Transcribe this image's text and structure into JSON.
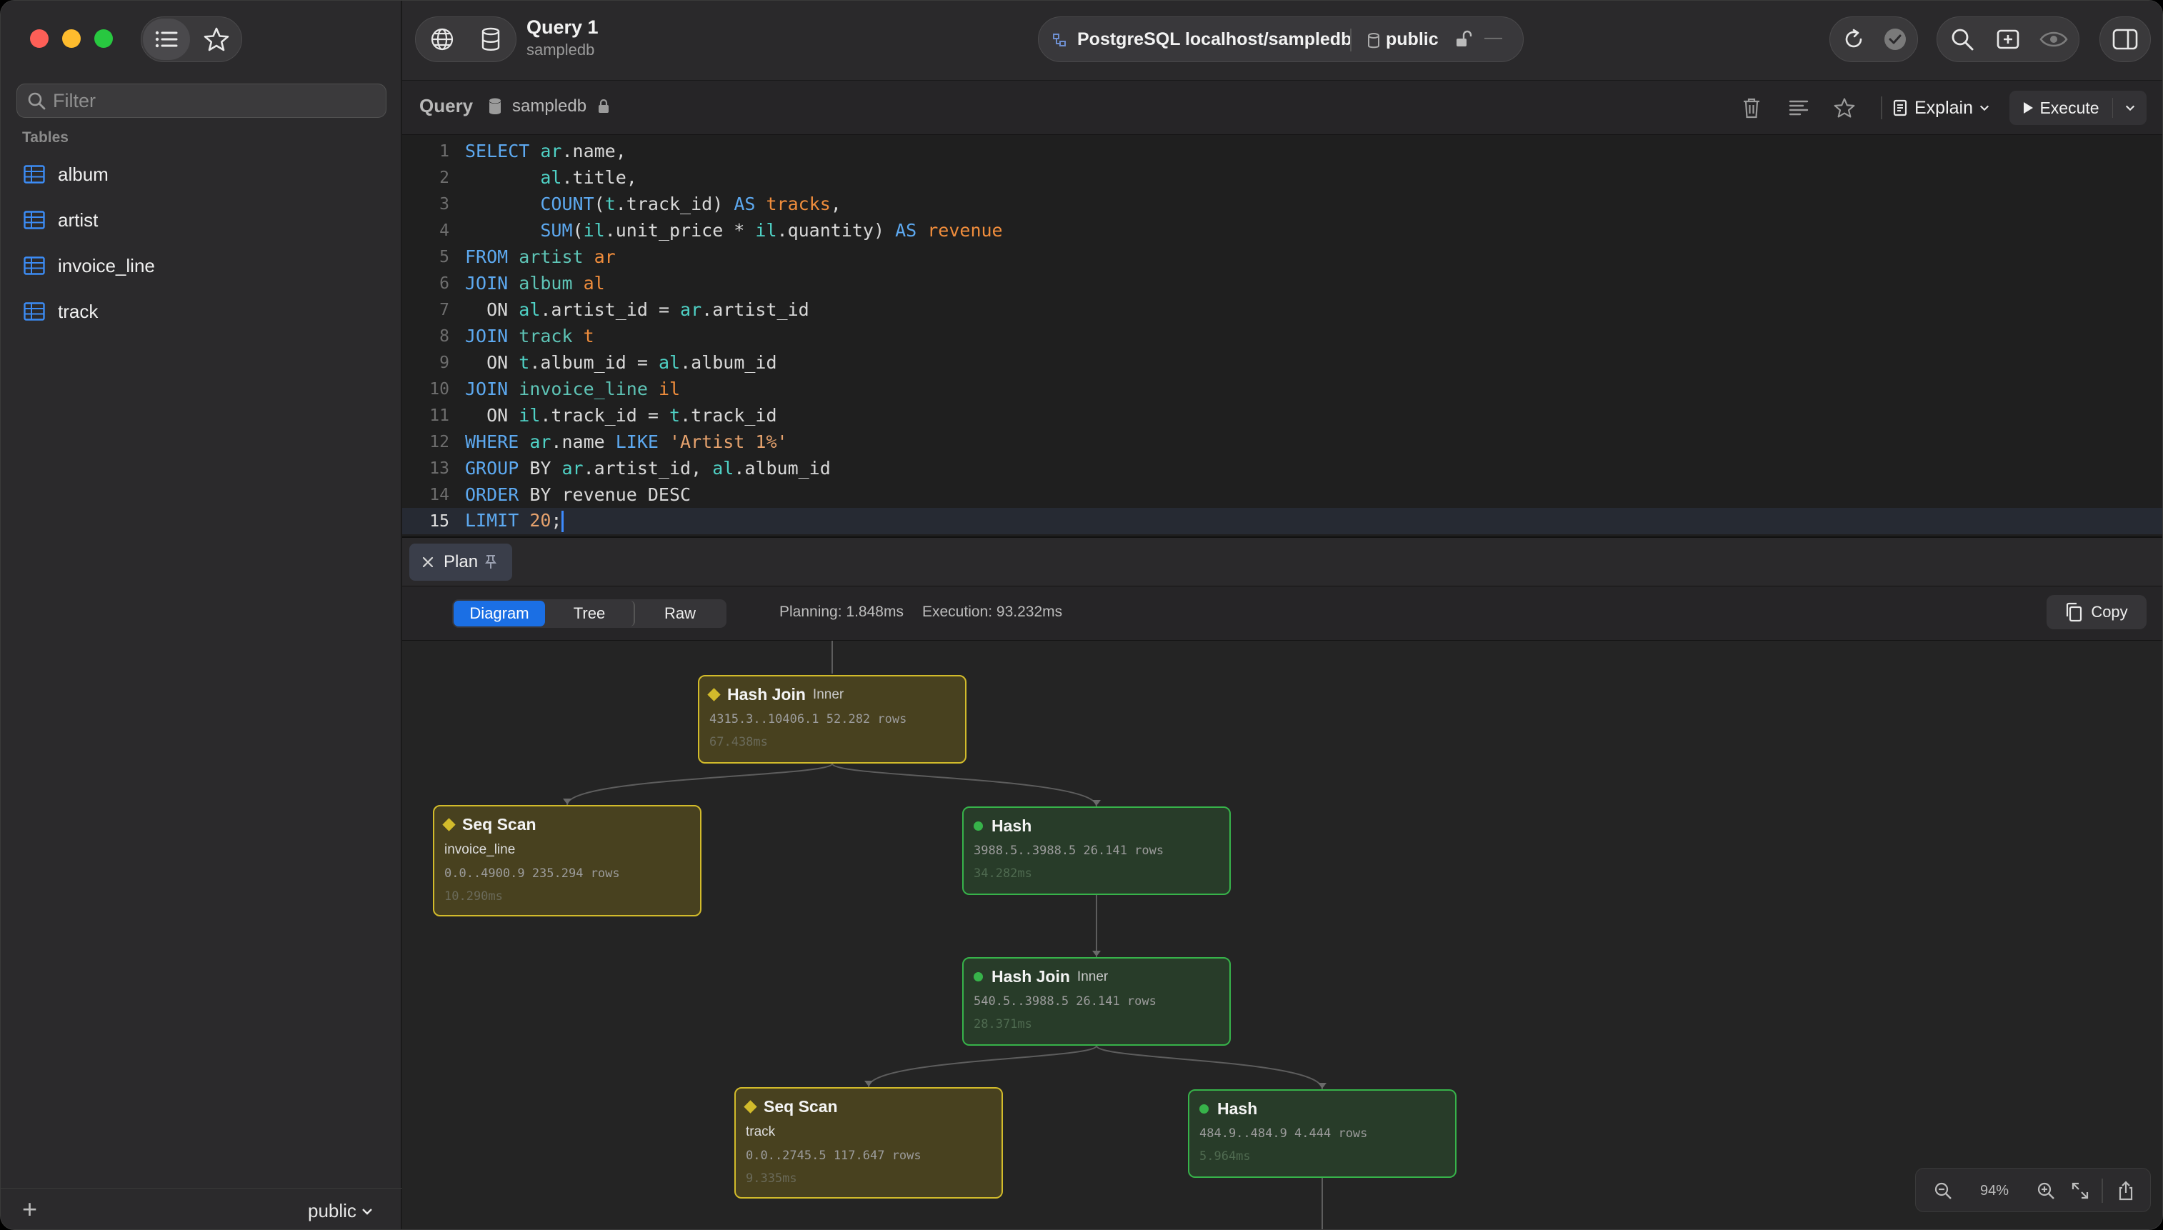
{
  "query_tab": {
    "title": "Query 1",
    "database": "sampledb"
  },
  "connection": {
    "label": "PostgreSQL localhost/sampledb",
    "schema": "public",
    "dash": "—"
  },
  "sidebar": {
    "filter_placeholder": "Filter",
    "section": "Tables",
    "tables": [
      "album",
      "artist",
      "invoice_line",
      "track"
    ],
    "footer_add": "+",
    "schema_select": "public"
  },
  "query_header": {
    "label": "Query",
    "database": "sampledb",
    "explain": "Explain",
    "execute": "Execute"
  },
  "editor": {
    "current_line": 15,
    "lines": [
      {
        "n": "1",
        "parts": [
          [
            "kw",
            "SELECT "
          ],
          [
            "al",
            "ar"
          ],
          [
            "tx",
            ".name,"
          ]
        ]
      },
      {
        "n": "2",
        "parts": [
          [
            "tx",
            "       "
          ],
          [
            "al",
            "al"
          ],
          [
            "tx",
            ".title,"
          ]
        ]
      },
      {
        "n": "3",
        "parts": [
          [
            "tx",
            "       "
          ],
          [
            "fn",
            "COUNT"
          ],
          [
            "tx",
            "("
          ],
          [
            "al",
            "t"
          ],
          [
            "tx",
            ".track_id) "
          ],
          [
            "kw",
            "AS "
          ],
          [
            "or",
            "tracks"
          ],
          [
            "tx",
            ","
          ]
        ]
      },
      {
        "n": "4",
        "parts": [
          [
            "tx",
            "       "
          ],
          [
            "fn",
            "SUM"
          ],
          [
            "tx",
            "("
          ],
          [
            "al",
            "il"
          ],
          [
            "tx",
            ".unit_price * "
          ],
          [
            "al",
            "il"
          ],
          [
            "tx",
            ".quantity) "
          ],
          [
            "kw",
            "AS "
          ],
          [
            "or",
            "revenue"
          ]
        ]
      },
      {
        "n": "5",
        "parts": [
          [
            "kw",
            "FROM "
          ],
          [
            "tb",
            "artist "
          ],
          [
            "or",
            "ar"
          ]
        ]
      },
      {
        "n": "6",
        "parts": [
          [
            "kw",
            "JOIN "
          ],
          [
            "tb",
            "album "
          ],
          [
            "or",
            "al"
          ]
        ]
      },
      {
        "n": "7",
        "parts": [
          [
            "tx",
            "  ON "
          ],
          [
            "al",
            "al"
          ],
          [
            "tx",
            ".artist_id = "
          ],
          [
            "al",
            "ar"
          ],
          [
            "tx",
            ".artist_id"
          ]
        ]
      },
      {
        "n": "8",
        "parts": [
          [
            "kw",
            "JOIN "
          ],
          [
            "tb",
            "track "
          ],
          [
            "or",
            "t"
          ]
        ]
      },
      {
        "n": "9",
        "parts": [
          [
            "tx",
            "  ON "
          ],
          [
            "al",
            "t"
          ],
          [
            "tx",
            ".album_id = "
          ],
          [
            "al",
            "al"
          ],
          [
            "tx",
            ".album_id"
          ]
        ]
      },
      {
        "n": "10",
        "parts": [
          [
            "kw",
            "JOIN "
          ],
          [
            "tb",
            "invoice_line "
          ],
          [
            "or",
            "il"
          ]
        ]
      },
      {
        "n": "11",
        "parts": [
          [
            "tx",
            "  ON "
          ],
          [
            "al",
            "il"
          ],
          [
            "tx",
            ".track_id = "
          ],
          [
            "al",
            "t"
          ],
          [
            "tx",
            ".track_id"
          ]
        ]
      },
      {
        "n": "12",
        "parts": [
          [
            "kw",
            "WHERE "
          ],
          [
            "al",
            "ar"
          ],
          [
            "tx",
            ".name "
          ],
          [
            "kw",
            "LIKE "
          ],
          [
            "st",
            "'Artist 1%'"
          ]
        ]
      },
      {
        "n": "13",
        "parts": [
          [
            "kw",
            "GROUP "
          ],
          [
            "tx",
            "BY "
          ],
          [
            "al",
            "ar"
          ],
          [
            "tx",
            ".artist_id, "
          ],
          [
            "al",
            "al"
          ],
          [
            "tx",
            ".album_id"
          ]
        ]
      },
      {
        "n": "14",
        "parts": [
          [
            "kw",
            "ORDER "
          ],
          [
            "tx",
            "BY revenue DESC"
          ]
        ]
      },
      {
        "n": "15",
        "parts": [
          [
            "kw",
            "LIMIT "
          ],
          [
            "nm",
            "20"
          ],
          [
            "tx",
            ";"
          ]
        ]
      }
    ]
  },
  "result_tab": {
    "label": "Plan"
  },
  "plan_toolbar": {
    "views": [
      "Diagram",
      "Tree",
      "Raw"
    ],
    "active_view": "Diagram",
    "planning": "Planning: 1.848ms",
    "execution": "Execution: 93.232ms",
    "copy": "Copy"
  },
  "plan_nodes": [
    {
      "id": "hj1",
      "title": "Hash Join",
      "join": "Inner",
      "sub": "",
      "cost": "4315.3..10406.1 52.282 rows",
      "time": "67.438ms",
      "color": "#d2bb2b"
    },
    {
      "id": "ss1",
      "title": "Seq Scan",
      "join": "",
      "sub": "invoice_line",
      "cost": "0.0..4900.9 235.294 rows",
      "time": "10.290ms",
      "color": "#d2bb2b"
    },
    {
      "id": "h1",
      "title": "Hash",
      "join": "",
      "sub": "",
      "cost": "3988.5..3988.5 26.141 rows",
      "time": "34.282ms",
      "color": "#37b34a"
    },
    {
      "id": "hj2",
      "title": "Hash Join",
      "join": "Inner",
      "sub": "",
      "cost": "540.5..3988.5 26.141 rows",
      "time": "28.371ms",
      "color": "#37b34a"
    },
    {
      "id": "ss2",
      "title": "Seq Scan",
      "join": "",
      "sub": "track",
      "cost": "0.0..2745.5 117.647 rows",
      "time": "9.335ms",
      "color": "#d2bb2b"
    },
    {
      "id": "h2",
      "title": "Hash",
      "join": "",
      "sub": "",
      "cost": "484.9..484.9 4.444 rows",
      "time": "5.964ms",
      "color": "#37b34a"
    }
  ],
  "zoom": {
    "level": "94%"
  }
}
